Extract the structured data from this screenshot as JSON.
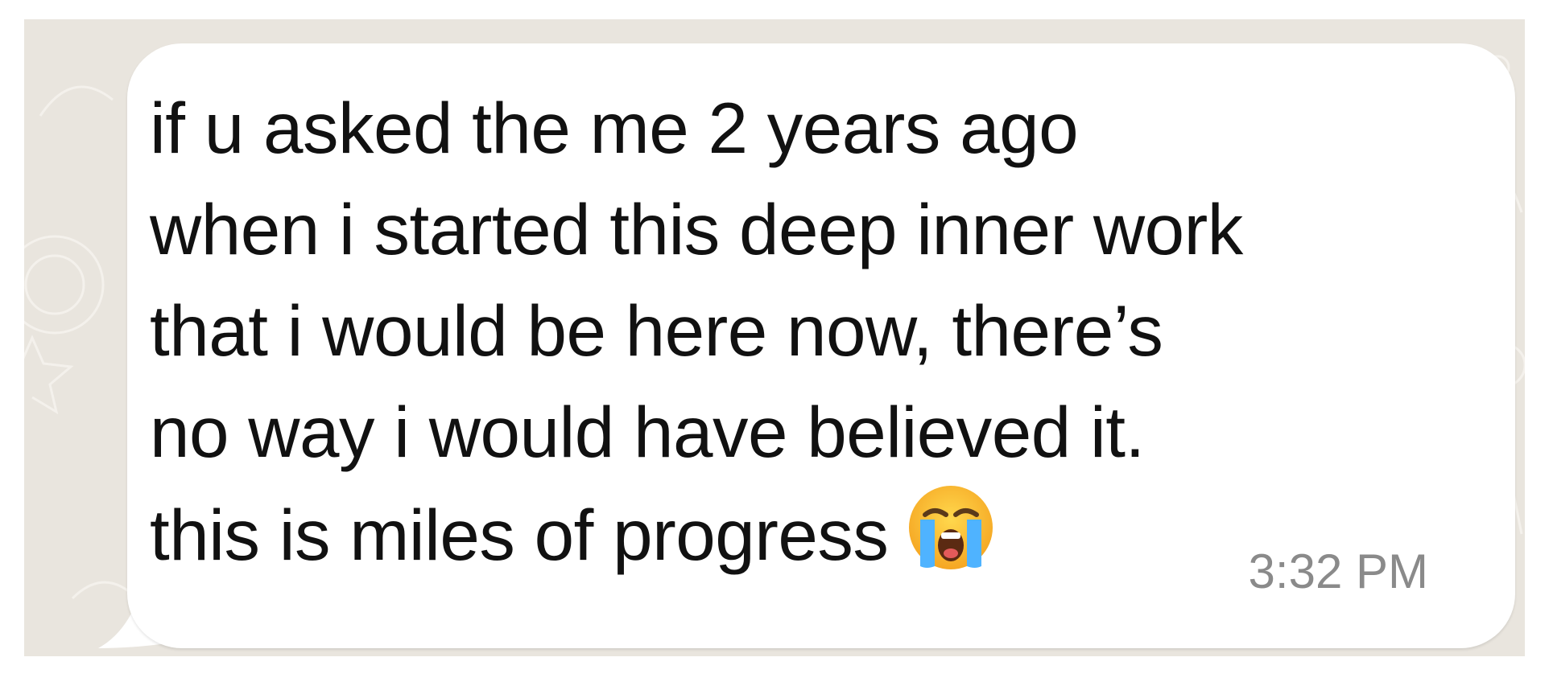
{
  "message": {
    "lines": [
      "if u asked the me 2 years ago",
      "when i started this deep inner work",
      "that i would be here now, there’s",
      "no way i would have believed it.",
      "this is miles of progress"
    ],
    "emoji": "loudly-crying-face",
    "timestamp": "3:32 PM"
  },
  "colors": {
    "chat_background": "#e9e5de",
    "bubble": "#ffffff",
    "text": "#111111",
    "timestamp": "#8a8a8a"
  }
}
